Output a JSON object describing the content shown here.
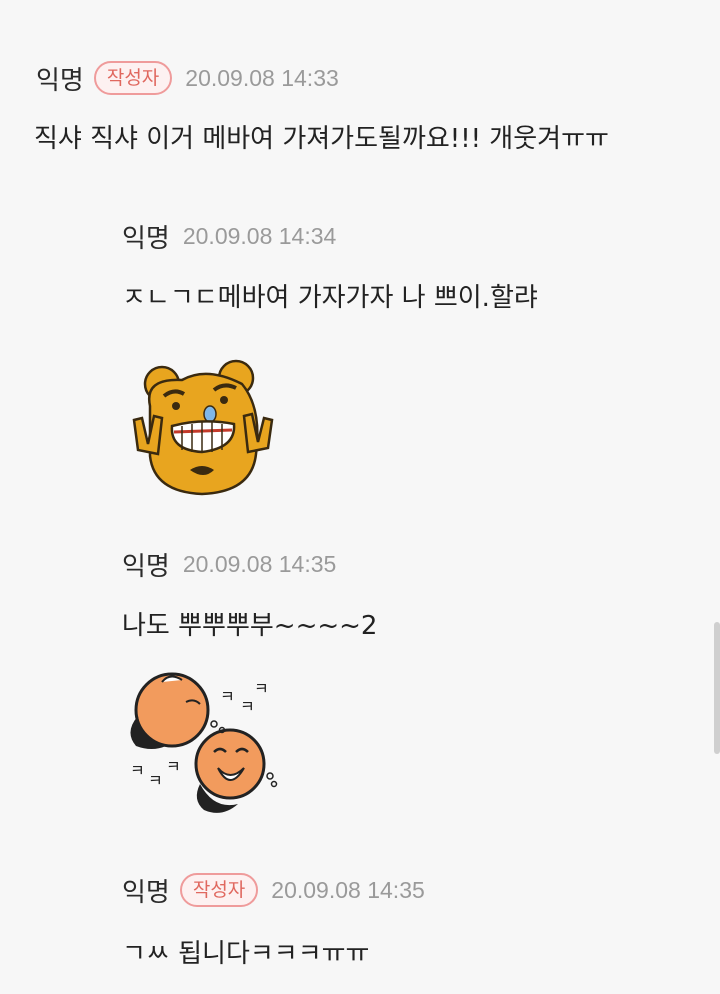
{
  "colors": {
    "background": "#f7f7f7",
    "badge_border": "#ef9b9b",
    "badge_text": "#e0685f",
    "timestamp": "#9a9a9a"
  },
  "comments": [
    {
      "author": "익명",
      "badge": "작성자",
      "timestamp": "20.09.08 14:33",
      "body": "직샤 직샤 이거 메바여 가져가도될까요!!! 개웃겨ㅠㅠ"
    },
    {
      "author": "익명",
      "timestamp": "20.09.08 14:34",
      "body": "ㅈㄴㄱㄷ메바여 가자가자 나 쁘이.할랴",
      "sticker": "sticker-bear-v-sign"
    },
    {
      "author": "익명",
      "timestamp": "20.09.08 14:35",
      "body": "나도 뿌뿌뿌부~~~~2",
      "sticker": "sticker-rolling-laughing",
      "sticker_text": [
        "ㅋ",
        "ㅋ",
        "ㅋ",
        "ㅋ",
        "ㅋ",
        "ㅋ"
      ]
    },
    {
      "author": "익명",
      "badge": "작성자",
      "timestamp": "20.09.08 14:35",
      "body": "ㄱㅆ 됩니다ㅋㅋㅋㅠㅠ"
    }
  ]
}
